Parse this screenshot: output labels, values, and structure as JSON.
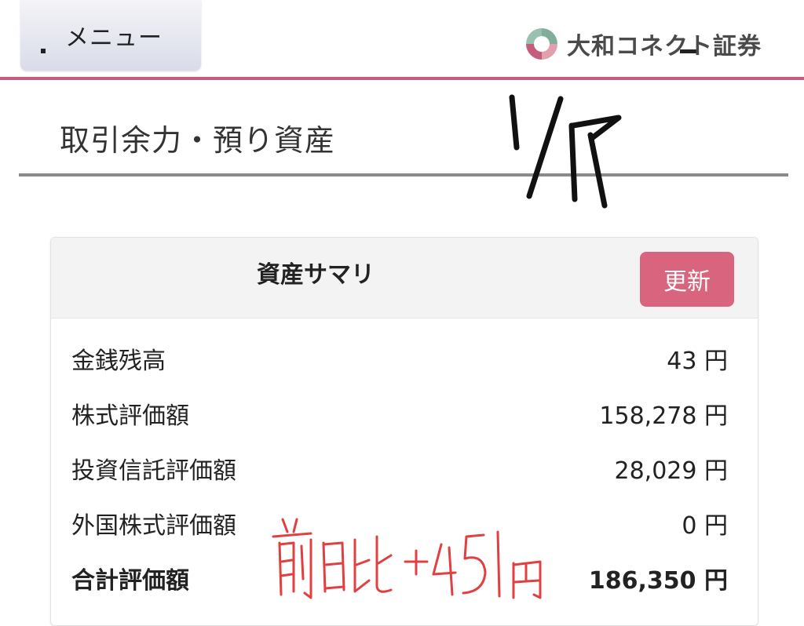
{
  "header": {
    "menu_label": "メニュー",
    "brand_name": "大和コネクト証券",
    "accent_color": "#c45d7b"
  },
  "page": {
    "title": "取引余力・預り資産"
  },
  "summary": {
    "title": "資産サマリ",
    "refresh_label": "更新",
    "refresh_color": "#d9647e",
    "rows": [
      {
        "label": "金銭残高",
        "value": "43 円"
      },
      {
        "label": "株式評価額",
        "value": "158,278 円"
      },
      {
        "label": "投資信託評価額",
        "value": "28,029 円"
      },
      {
        "label": "外国株式評価額",
        "value": "0 円"
      },
      {
        "label": "合計評価額",
        "value": "186,350 円"
      }
    ]
  },
  "annotations": {
    "date": "1/17",
    "note": "前日比 +451円",
    "note_color": "#e04040"
  }
}
